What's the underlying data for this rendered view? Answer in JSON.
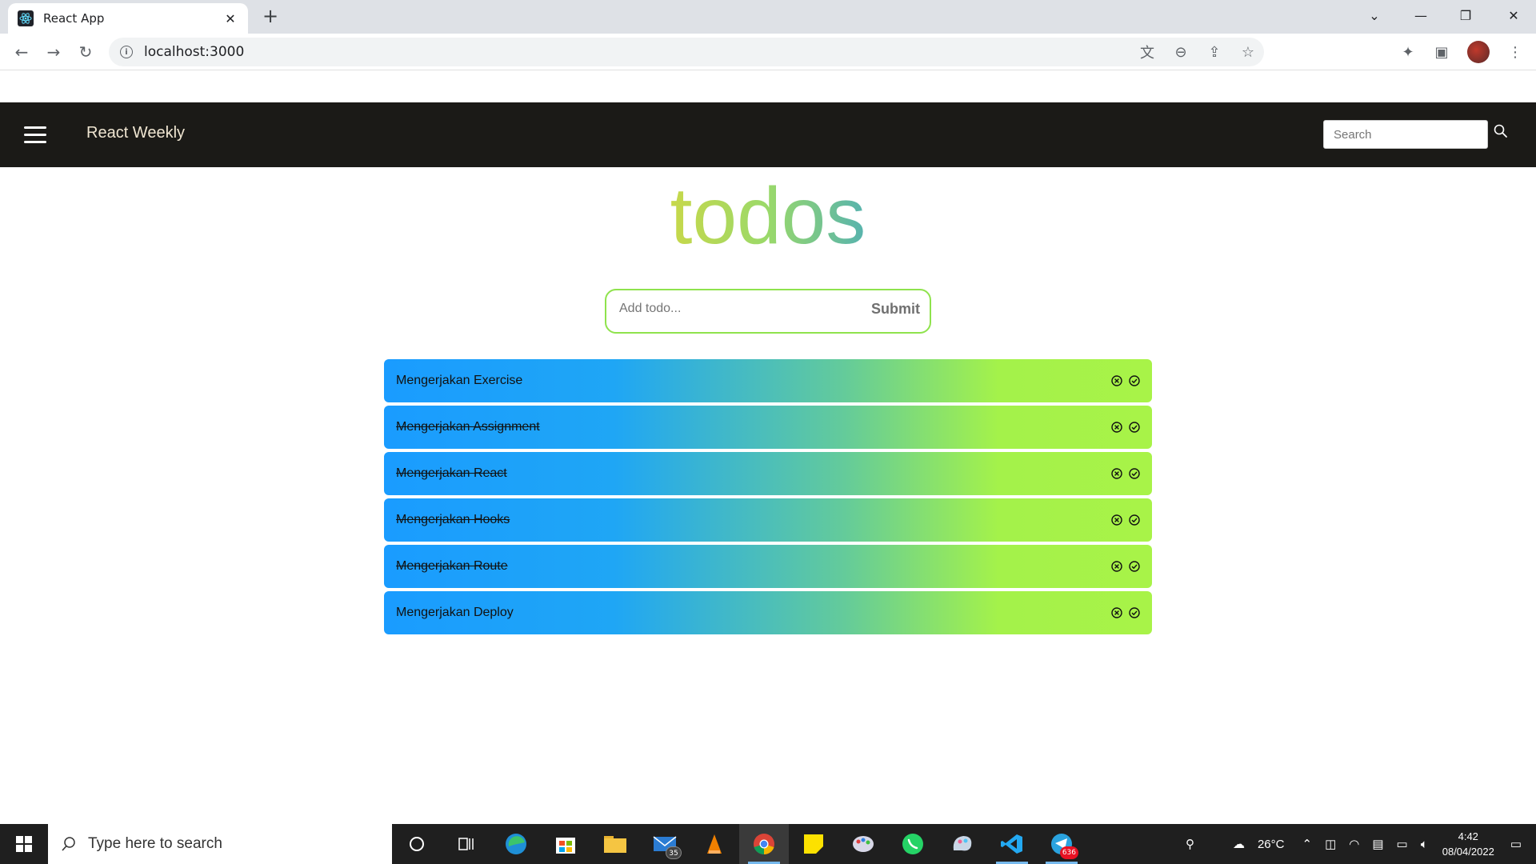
{
  "browser": {
    "tab_title": "React App",
    "url": "localhost:3000"
  },
  "navbar": {
    "brand": "React Weekly",
    "search_placeholder": "Search"
  },
  "app": {
    "title": "todos",
    "input_placeholder": "Add todo...",
    "submit_label": "Submit",
    "todos": [
      {
        "text": "Mengerjakan Exercise",
        "completed": false
      },
      {
        "text": "Mengerjakan Assignment",
        "completed": true
      },
      {
        "text": "Mengerjakan React",
        "completed": true
      },
      {
        "text": "Mengerjakan Hooks",
        "completed": true
      },
      {
        "text": "Mengerjakan Route",
        "completed": true
      },
      {
        "text": "Mengerjakan Deploy",
        "completed": false
      }
    ]
  },
  "taskbar": {
    "search_placeholder": "Type here to search",
    "mail_badge": "35",
    "telegram_badge": "636",
    "weather": "26°C",
    "time": "4:42",
    "date": "08/04/2022"
  },
  "colors": {
    "navbar_bg": "#1b1a17",
    "todo_gradient_start": "#1a9cff",
    "todo_gradient_end": "#a8f348",
    "form_border": "#8fe34d"
  }
}
